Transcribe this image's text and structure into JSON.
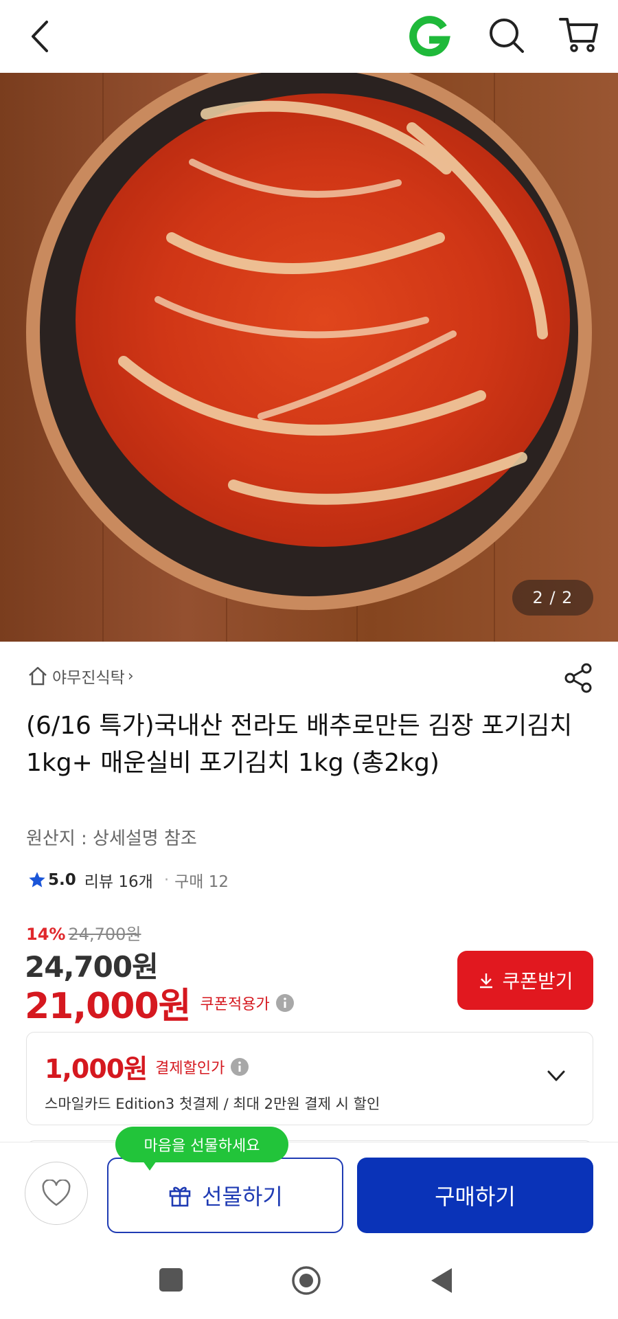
{
  "topbar": {
    "icons": [
      "back-arrow-icon",
      "gmarket-logo",
      "search-icon",
      "cart-icon"
    ],
    "logo_color": "#1fb93a"
  },
  "gallery": {
    "counter": "2 / 2"
  },
  "product": {
    "store_name": "야무진식탁",
    "store_chevron": "›",
    "title": "(6/16 특가)국내산 전라도 배추로만든 김장 포기김치 1kg+ 매운실비 포기김치 1kg (총2kg)",
    "origin": "원산지 : 상세설명 참조",
    "rating": "5.0",
    "review_label": "리뷰 16개",
    "separator": "·",
    "purchase_label": "구매 12"
  },
  "pricing": {
    "discount_pct": "14%",
    "original_price": "24,700원",
    "price": "24,700원",
    "coupon_price": "21,000원",
    "coupon_price_label": "쿠폰적용가",
    "coupon_button": "쿠폰받기",
    "accent_color": "#d5181f"
  },
  "payment_discount": {
    "amount": "1,000원",
    "label": "결제할인가",
    "description": "스마일카드 Edition3 첫결제 / 최대 2만원 결제 시 할인"
  },
  "actions": {
    "tooltip": "마음을 선물하세요",
    "gift_button": "선물하기",
    "buy_button": "구매하기",
    "brand_color": "#0a33b8"
  }
}
